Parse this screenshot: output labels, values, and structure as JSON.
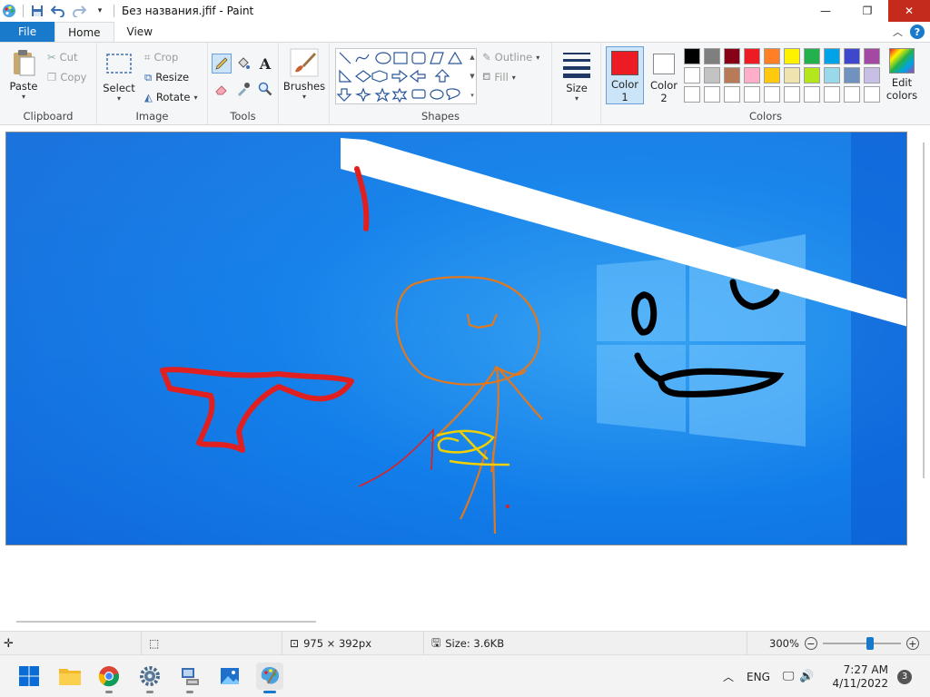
{
  "window": {
    "title": "Без названия.jfif - Paint",
    "minimize": "—",
    "maximize": "❐",
    "close": "✕"
  },
  "tabs": {
    "file": "File",
    "home": "Home",
    "view": "View"
  },
  "ribbon": {
    "clipboard": {
      "label": "Clipboard",
      "paste": "Paste",
      "cut": "Cut",
      "copy": "Copy"
    },
    "image": {
      "label": "Image",
      "select": "Select",
      "crop": "Crop",
      "resize": "Resize",
      "rotate": "Rotate"
    },
    "tools": {
      "label": "Tools"
    },
    "brushes": {
      "label": "Brushes"
    },
    "shapes": {
      "label": "Shapes",
      "outline": "Outline",
      "fill": "Fill"
    },
    "size": {
      "label": "Size"
    },
    "colors": {
      "label": "Colors",
      "color1": "Color",
      "color1_num": "1",
      "color2": "Color",
      "color2_num": "2",
      "edit": "Edit",
      "edit2": "colors",
      "color1_value": "#ed1c24",
      "color2_value": "#ffffff",
      "palette_row1": [
        "#000000",
        "#7f7f7f",
        "#880015",
        "#ed1c24",
        "#ff7f27",
        "#fff200",
        "#22b14c",
        "#00a2e8",
        "#3f48cc",
        "#a349a4"
      ],
      "palette_row2": [
        "#ffffff",
        "#c3c3c3",
        "#b97a57",
        "#ffaec9",
        "#ffc90e",
        "#efe4b0",
        "#b5e61d",
        "#99d9ea",
        "#7092be",
        "#c8bfe7"
      ]
    }
  },
  "status": {
    "dimensions": "975 × 392px",
    "size": "Size: 3.6KB",
    "zoom": "300%",
    "zoom_minus": "−",
    "zoom_plus": "+"
  },
  "taskbar": {
    "lang": "ENG",
    "time": "7:27 AM",
    "date": "4/11/2022",
    "notifications": "3"
  }
}
